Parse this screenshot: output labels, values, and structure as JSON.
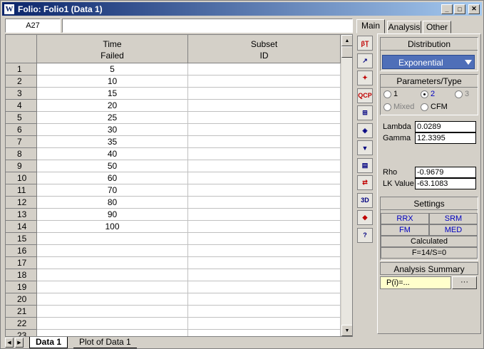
{
  "window": {
    "app_icon": "W",
    "title": "Folio: Folio1 (Data 1)",
    "min_glyph": "_",
    "max_glyph": "□",
    "close_glyph": "✕"
  },
  "formula_bar": {
    "cell_ref": "A27",
    "value": ""
  },
  "grid": {
    "columns": [
      {
        "line1": "Time",
        "line2": "Failed"
      },
      {
        "line1": "Subset",
        "line2": "ID"
      }
    ],
    "rows": [
      {
        "n": "1",
        "time": "5",
        "subset": ""
      },
      {
        "n": "2",
        "time": "10",
        "subset": ""
      },
      {
        "n": "3",
        "time": "15",
        "subset": ""
      },
      {
        "n": "4",
        "time": "20",
        "subset": ""
      },
      {
        "n": "5",
        "time": "25",
        "subset": ""
      },
      {
        "n": "6",
        "time": "30",
        "subset": ""
      },
      {
        "n": "7",
        "time": "35",
        "subset": ""
      },
      {
        "n": "8",
        "time": "40",
        "subset": ""
      },
      {
        "n": "9",
        "time": "50",
        "subset": ""
      },
      {
        "n": "10",
        "time": "60",
        "subset": ""
      },
      {
        "n": "11",
        "time": "70",
        "subset": ""
      },
      {
        "n": "12",
        "time": "80",
        "subset": ""
      },
      {
        "n": "13",
        "time": "90",
        "subset": ""
      },
      {
        "n": "14",
        "time": "100",
        "subset": ""
      },
      {
        "n": "15",
        "time": "",
        "subset": ""
      },
      {
        "n": "16",
        "time": "",
        "subset": ""
      },
      {
        "n": "17",
        "time": "",
        "subset": ""
      },
      {
        "n": "18",
        "time": "",
        "subset": ""
      },
      {
        "n": "19",
        "time": "",
        "subset": ""
      },
      {
        "n": "20",
        "time": "",
        "subset": ""
      },
      {
        "n": "21",
        "time": "",
        "subset": ""
      },
      {
        "n": "22",
        "time": "",
        "subset": ""
      },
      {
        "n": "23",
        "time": "",
        "subset": ""
      }
    ]
  },
  "sheet_tabs": {
    "active": "Data 1",
    "inactive": "Plot of Data 1"
  },
  "toolstrip": {
    "tools": [
      {
        "name": "beta-icon",
        "glyph": "βŢ",
        "color": "#c00000"
      },
      {
        "name": "plot-icon",
        "glyph": "↗",
        "color": "#000080"
      },
      {
        "name": "wand-icon",
        "glyph": "✦",
        "color": "#c00000"
      },
      {
        "name": "qcp-icon",
        "glyph": "QCP",
        "color": "#c00000"
      },
      {
        "name": "grid-plot-icon",
        "glyph": "⊞",
        "color": "#000080"
      },
      {
        "name": "diamond-info-icon",
        "glyph": "◈",
        "color": "#000080"
      },
      {
        "name": "funnel-icon",
        "glyph": "▼",
        "color": "#000080"
      },
      {
        "name": "report-icon",
        "glyph": "▤",
        "color": "#000080"
      },
      {
        "name": "transfer-icon",
        "glyph": "⇄",
        "color": "#c00000"
      },
      {
        "name": "3d-plot-icon",
        "glyph": "3D",
        "color": "#000080"
      },
      {
        "name": "batch-icon",
        "glyph": "◆",
        "color": "#c00000"
      },
      {
        "name": "help-icon",
        "glyph": "?",
        "color": "#000080"
      }
    ]
  },
  "panel": {
    "tabs": [
      "Main",
      "Analysis",
      "Other"
    ],
    "distribution": {
      "title": "Distribution",
      "selected": "Exponential"
    },
    "params": {
      "title": "Parameters/Type",
      "r1": "1",
      "r2": "2",
      "r3": "3",
      "mixed": "Mixed",
      "cfm": "CFM"
    },
    "results": {
      "lambda_label": "Lambda",
      "lambda_value": "0.0289",
      "gamma_label": "Gamma",
      "gamma_value": "12.3395",
      "rho_label": "Rho",
      "rho_value": "-0.9679",
      "lk_label": "LK Value",
      "lk_value": "-63.1083"
    },
    "settings": {
      "title": "Settings",
      "rrx": "RRX",
      "srm": "SRM",
      "fm": "FM",
      "med": "MED",
      "calculated": "Calculated",
      "fs": "F=14/S=0"
    },
    "summary": {
      "title": "Analysis Summary",
      "value": "P(i)=...",
      "btn": "···"
    }
  }
}
